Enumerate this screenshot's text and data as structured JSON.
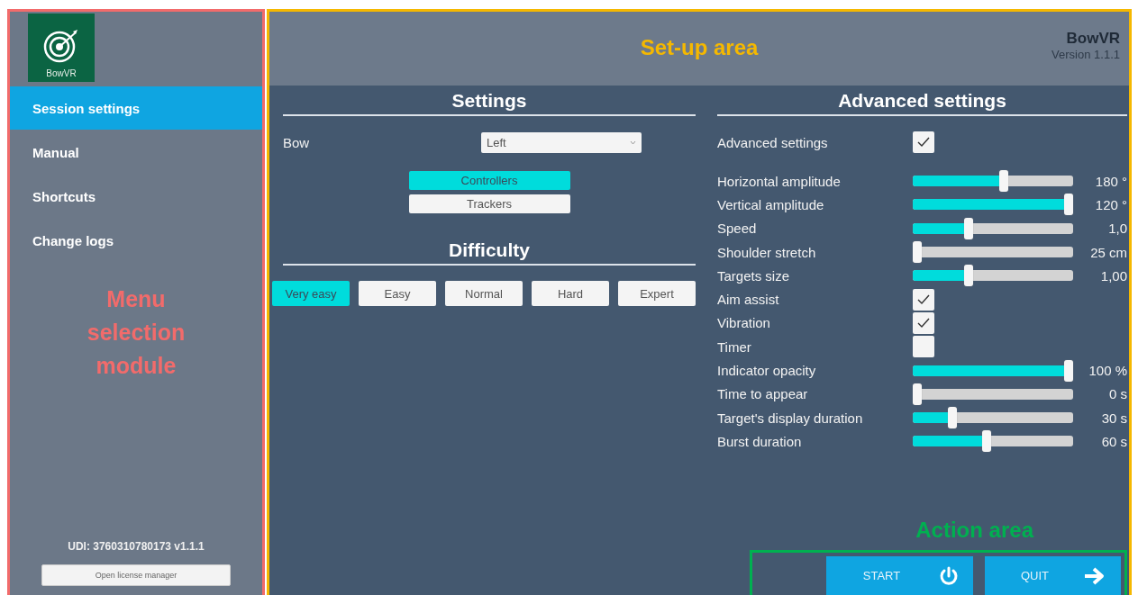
{
  "logo": {
    "text": "BowVR"
  },
  "sidebar": {
    "items": [
      {
        "label": "Session settings",
        "selected": true
      },
      {
        "label": "Manual",
        "selected": false
      },
      {
        "label": "Shortcuts",
        "selected": false
      },
      {
        "label": "Change logs",
        "selected": false
      }
    ],
    "udi": "UDI:  3760310780173 v1.1.1",
    "license_button": "Open license manager"
  },
  "header": {
    "app_name": "BowVR",
    "version": "Version 1.1.1"
  },
  "settings": {
    "title": "Settings",
    "bow": {
      "label": "Bow",
      "value": "Left"
    },
    "input_modes": [
      {
        "label": "Controllers",
        "selected": true
      },
      {
        "label": "Trackers",
        "selected": false
      }
    ],
    "difficulty_title": "Difficulty",
    "difficulties": [
      {
        "label": "Very easy",
        "selected": true
      },
      {
        "label": "Easy",
        "selected": false
      },
      {
        "label": "Normal",
        "selected": false
      },
      {
        "label": "Hard",
        "selected": false
      },
      {
        "label": "Expert",
        "selected": false
      }
    ]
  },
  "advanced": {
    "title": "Advanced settings",
    "toggle": {
      "label": "Advanced settings",
      "checked": true
    },
    "rows": [
      {
        "kind": "slider",
        "label": "Horizontal amplitude",
        "level": 0.57,
        "reading": "180 °"
      },
      {
        "kind": "slider",
        "label": "Vertical amplitude",
        "level": 1.0,
        "reading": "120 °"
      },
      {
        "kind": "slider",
        "label": "Speed",
        "level": 0.34,
        "reading": "1,0"
      },
      {
        "kind": "slider",
        "label": "Shoulder stretch",
        "level": 0.0,
        "reading": "25 cm"
      },
      {
        "kind": "slider",
        "label": "Targets size",
        "level": 0.34,
        "reading": "1,00"
      },
      {
        "kind": "checkbox",
        "label": "Aim assist",
        "checked": true
      },
      {
        "kind": "checkbox",
        "label": "Vibration",
        "checked": true
      },
      {
        "kind": "checkbox",
        "label": "Timer",
        "checked": false
      },
      {
        "kind": "slider",
        "label": "Indicator opacity",
        "level": 1.0,
        "reading": "100 %"
      },
      {
        "kind": "slider",
        "label": "Time to appear",
        "level": 0.0,
        "reading": "0 s"
      },
      {
        "kind": "slider",
        "label": "Target's display duration",
        "level": 0.23,
        "reading": "30 s"
      },
      {
        "kind": "slider",
        "label": "Burst duration",
        "level": 0.46,
        "reading": "60 s"
      }
    ]
  },
  "actions": [
    {
      "label": "START",
      "kind": "power"
    },
    {
      "label": "QUIT",
      "kind": "arrow"
    }
  ],
  "annotations": {
    "menu": "Menu selection module",
    "setup": "Set-up area",
    "action": "Action area"
  }
}
